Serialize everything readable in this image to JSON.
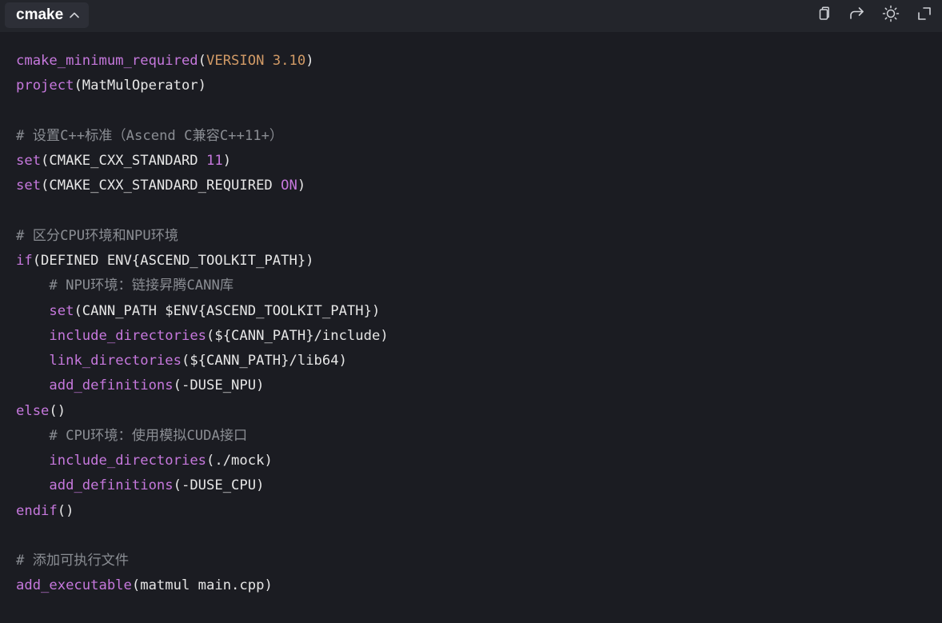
{
  "codeblock": {
    "language": "cmake",
    "icons": {
      "collapse": "chevron-up-icon",
      "copy": "copy-icon",
      "wrap": "wrap-arrow-icon",
      "theme": "sun-icon",
      "expand": "expand-icon"
    },
    "colors": {
      "background": "#1b1c22",
      "toolbar": "#23252b",
      "function": "#c678dd",
      "version": "#d19a66",
      "comment": "#8a8d93",
      "text": "#e6e6e6"
    }
  },
  "code_lines": [
    [
      {
        "t": "cmake_minimum_required",
        "c": "fn"
      },
      {
        "t": "(",
        "c": "plain"
      },
      {
        "t": "VERSION",
        "c": "ver"
      },
      {
        "t": " 3.10",
        "c": "ver"
      },
      {
        "t": ")",
        "c": "plain"
      }
    ],
    [
      {
        "t": "project",
        "c": "fn"
      },
      {
        "t": "(MatMulOperator)",
        "c": "plain"
      }
    ],
    [],
    [
      {
        "t": "# 设置C++标准（Ascend C兼容C++11+）",
        "c": "cmt"
      }
    ],
    [
      {
        "t": "set",
        "c": "fn"
      },
      {
        "t": "(CMAKE_CXX_STANDARD ",
        "c": "plain"
      },
      {
        "t": "11",
        "c": "num"
      },
      {
        "t": ")",
        "c": "plain"
      }
    ],
    [
      {
        "t": "set",
        "c": "fn"
      },
      {
        "t": "(CMAKE_CXX_STANDARD_REQUIRED ",
        "c": "plain"
      },
      {
        "t": "ON",
        "c": "num"
      },
      {
        "t": ")",
        "c": "plain"
      }
    ],
    [],
    [
      {
        "t": "# 区分CPU环境和NPU环境",
        "c": "cmt"
      }
    ],
    [
      {
        "t": "if",
        "c": "kw"
      },
      {
        "t": "(DEFINED ENV{ASCEND_TOOLKIT_PATH})",
        "c": "plain"
      }
    ],
    [
      {
        "t": "    ",
        "c": "plain"
      },
      {
        "t": "# NPU环境：链接昇腾CANN库",
        "c": "cmt"
      }
    ],
    [
      {
        "t": "    ",
        "c": "plain"
      },
      {
        "t": "set",
        "c": "fn"
      },
      {
        "t": "(CANN_PATH $ENV{ASCEND_TOOLKIT_PATH})",
        "c": "plain"
      }
    ],
    [
      {
        "t": "    ",
        "c": "plain"
      },
      {
        "t": "include_directories",
        "c": "fn"
      },
      {
        "t": "(${CANN_PATH}/include)",
        "c": "plain"
      }
    ],
    [
      {
        "t": "    ",
        "c": "plain"
      },
      {
        "t": "link_directories",
        "c": "fn"
      },
      {
        "t": "(${CANN_PATH}/lib64)",
        "c": "plain"
      }
    ],
    [
      {
        "t": "    ",
        "c": "plain"
      },
      {
        "t": "add_definitions",
        "c": "fn"
      },
      {
        "t": "(-DUSE_NPU)",
        "c": "plain"
      }
    ],
    [
      {
        "t": "else",
        "c": "kw"
      },
      {
        "t": "()",
        "c": "plain"
      }
    ],
    [
      {
        "t": "    ",
        "c": "plain"
      },
      {
        "t": "# CPU环境：使用模拟CUDA接口",
        "c": "cmt"
      }
    ],
    [
      {
        "t": "    ",
        "c": "plain"
      },
      {
        "t": "include_directories",
        "c": "fn"
      },
      {
        "t": "(./mock)",
        "c": "plain"
      }
    ],
    [
      {
        "t": "    ",
        "c": "plain"
      },
      {
        "t": "add_definitions",
        "c": "fn"
      },
      {
        "t": "(-DUSE_CPU)",
        "c": "plain"
      }
    ],
    [
      {
        "t": "endif",
        "c": "kw"
      },
      {
        "t": "()",
        "c": "plain"
      }
    ],
    [],
    [
      {
        "t": "# 添加可执行文件",
        "c": "cmt"
      }
    ],
    [
      {
        "t": "add_executable",
        "c": "fn"
      },
      {
        "t": "(matmul main.cpp)",
        "c": "plain"
      }
    ]
  ]
}
